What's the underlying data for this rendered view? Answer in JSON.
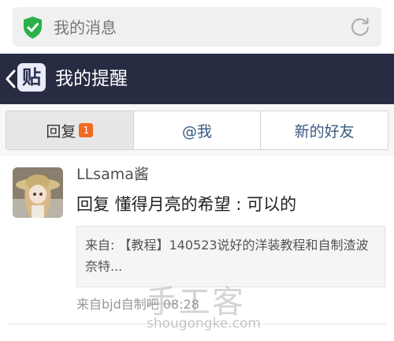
{
  "browser": {
    "url_text": "我的消息",
    "icons": {
      "secure": "shield-check-icon",
      "reload": "reload-icon"
    }
  },
  "navbar": {
    "logo_text": "贴",
    "title": "我的提醒",
    "icons": {
      "back": "chevron-left-icon"
    }
  },
  "tabs": [
    {
      "label": "回复",
      "badge": "1",
      "active": true
    },
    {
      "label": "@我",
      "active": false
    },
    {
      "label": "新的好友",
      "active": false
    }
  ],
  "message": {
    "username": "LLsama酱",
    "reply_text": "回复 懂得月亮的希望 : 可以的",
    "quote_text": "来自: 【教程】140523说好的洋装教程和自制渣波奈特...",
    "source_text": "来自bjd自制吧 08:28"
  },
  "watermark": {
    "logo_text": "手工客",
    "url_text": "shougongke.com"
  },
  "colors": {
    "navbar_bg": "#282c43",
    "badge": "#f26a22",
    "secure_green": "#2db04a",
    "tab_link": "#3a5a82"
  }
}
